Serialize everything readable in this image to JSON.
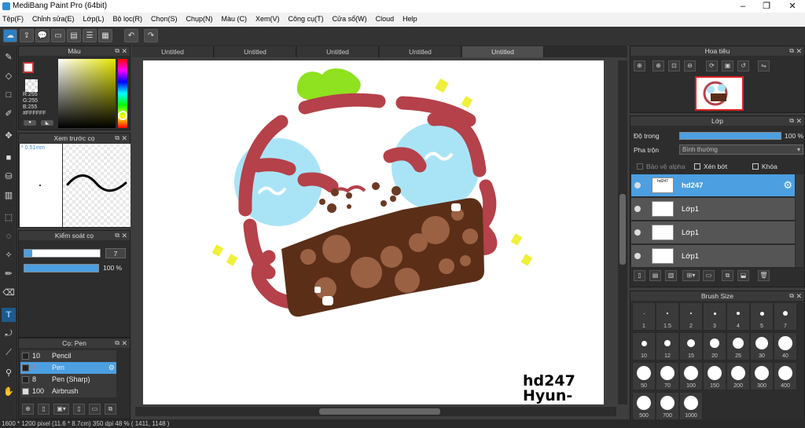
{
  "window": {
    "title": "MediBang Paint Pro (64bit)"
  },
  "menu": [
    "Tệp(F)",
    "Chỉnh sửa(E)",
    "Lớp(L)",
    "Bộ lọc(R)",
    "Chọn(S)",
    "Chụp(N)",
    "Màu (C)",
    "Xem(V)",
    "Công cụ(T)",
    "Cửa sổ(W)",
    "Cloud",
    "Help"
  ],
  "tabs": [
    "Untitled",
    "Untitled",
    "Untitled",
    "Untitled",
    "Untitled"
  ],
  "color_panel": {
    "title": "Màu",
    "r": "R:255",
    "g": "G:255",
    "b": "B:255",
    "hex": "#FFFFFF"
  },
  "preview_panel": {
    "title": "Xem trước cọ",
    "size": "* 0.51mm"
  },
  "brush_control": {
    "title": "Kiểm soát cọ",
    "size_value": "7",
    "opacity_value": "100 %"
  },
  "brush_panel": {
    "title": "Cọ: Pen",
    "items": [
      {
        "size": "10",
        "name": "Pencil"
      },
      {
        "size": "7",
        "name": "Pen"
      },
      {
        "size": "8",
        "name": "Pen (Sharp)"
      },
      {
        "size": "100",
        "name": "Airbrush"
      }
    ]
  },
  "navigator": {
    "title": "Hoa tiêu"
  },
  "layer_panel": {
    "title": "Lớp",
    "opacity_label": "Độ trong",
    "opacity_value": "100 %",
    "blend_label": "Pha trộn",
    "blend_value": "Bình thường",
    "protect_alpha": "Bảo vệ alpha",
    "clipping": "Xén bớt",
    "lock": "Khóa",
    "layers": [
      "hd247",
      "Lớp1",
      "Lớp1",
      "Lớp1"
    ]
  },
  "brush_size": {
    "title": "Brush Size",
    "sizes": [
      "1",
      "1.5",
      "2",
      "3",
      "4",
      "5",
      "7",
      "10",
      "12",
      "15",
      "20",
      "25",
      "30",
      "40",
      "50",
      "70",
      "100",
      "150",
      "200",
      "300",
      "400",
      "500",
      "700",
      "1000"
    ]
  },
  "canvas": {
    "signature_line1": "hd247",
    "signature_line2": "Hyun-woo"
  },
  "status": "1600 * 1200 pixel   (11.6 * 8.7cm)   350 dpi   48 %   ( 1411, 1148 )",
  "colors": {
    "accent": "#4c9fe0",
    "foreground": "#ffffff",
    "stroke": "#b5414a"
  }
}
